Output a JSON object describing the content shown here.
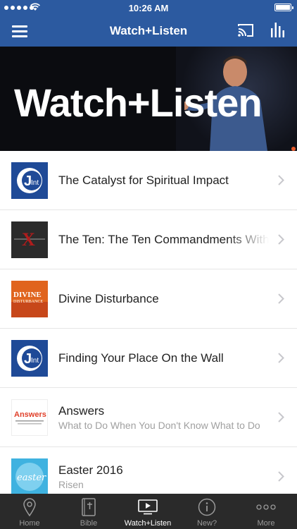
{
  "status_bar": {
    "time": "10:26 AM"
  },
  "nav": {
    "title": "Watch+Listen"
  },
  "hero": {
    "headline": "Watch+Listen"
  },
  "list": [
    {
      "title": "The Catalyst for Spiritual Impact",
      "subtitle": ""
    },
    {
      "title": "The Ten: The Ten Commandments With",
      "subtitle": ""
    },
    {
      "title": "Divine Disturbance",
      "subtitle": ""
    },
    {
      "title": "Finding Your Place On the Wall",
      "subtitle": ""
    },
    {
      "title": "Answers",
      "subtitle": "What to Do When You Don't Know What to Do"
    },
    {
      "title": "Easter 2016",
      "subtitle": "Risen"
    }
  ],
  "thumbs": {
    "jint_j": "J",
    "jint_int": "Int",
    "ten_x": "X",
    "divine_1": "DIVINE",
    "divine_2": "DISTURBANCE",
    "answers": "Answers",
    "easter": "easter"
  },
  "tabs": [
    {
      "label": "Home",
      "icon": "location-pin-icon"
    },
    {
      "label": "Bible",
      "icon": "bible-book-icon"
    },
    {
      "label": "Watch+Listen",
      "icon": "play-screen-icon",
      "active": true
    },
    {
      "label": "New?",
      "icon": "info-circle-icon"
    },
    {
      "label": "More",
      "icon": "more-dots-icon"
    }
  ],
  "colors": {
    "nav_blue": "#2c5aa0",
    "tab_bar": "#2a2a2a"
  }
}
